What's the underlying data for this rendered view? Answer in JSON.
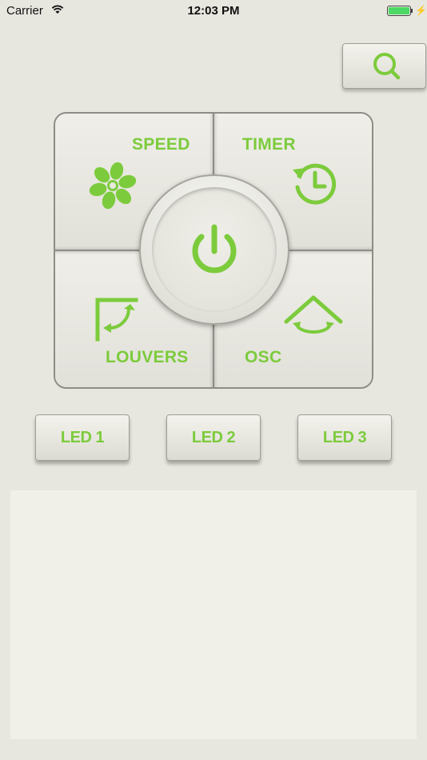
{
  "status_bar": {
    "carrier": "Carrier",
    "time": "12:03 PM"
  },
  "search": {
    "icon": "search-icon"
  },
  "pad": {
    "speed_label": "SPEED",
    "timer_label": "TIMER",
    "louvers_label": "LOUVERS",
    "osc_label": "OSC",
    "power_icon": "power-icon"
  },
  "leds": [
    "LED 1",
    "LED 2",
    "LED 3"
  ],
  "colors": {
    "accent": "#7ccb3c",
    "background": "#e7e6df",
    "panel": "#f0efe8"
  }
}
